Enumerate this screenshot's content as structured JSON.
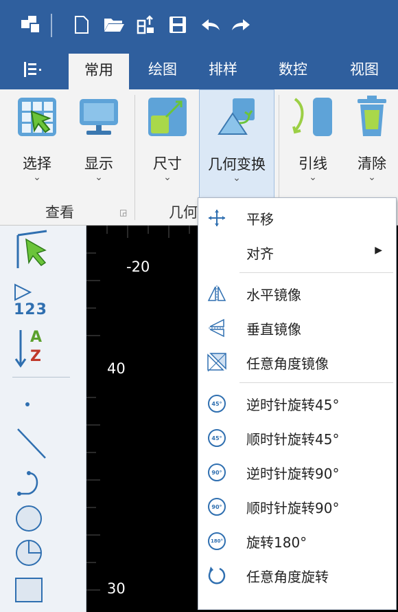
{
  "tabs": [
    {
      "label": "常用",
      "active": true
    },
    {
      "label": "绘图"
    },
    {
      "label": "排样"
    },
    {
      "label": "数控"
    },
    {
      "label": "视图"
    }
  ],
  "ribbon": {
    "buttons": [
      {
        "label": "选择",
        "arrow": "⌄"
      },
      {
        "label": "显示",
        "arrow": "⌄"
      },
      {
        "label": "尺寸",
        "arrow": "⌄"
      },
      {
        "label": "几何变换",
        "arrow": "⌄"
      },
      {
        "label": "引线",
        "arrow": "⌄"
      },
      {
        "label": "清除",
        "arrow": "⌄"
      }
    ],
    "groups": [
      "查看",
      "几何"
    ]
  },
  "left_toolbar": {
    "sort_digits": "123",
    "sort_letters": [
      "A",
      "Z"
    ]
  },
  "canvas": {
    "coords": [
      "-20",
      "40",
      "30"
    ]
  },
  "menu": {
    "items": [
      {
        "label": "平移"
      },
      {
        "label": "对齐",
        "submenu": "▶"
      },
      {
        "label": "水平镜像"
      },
      {
        "label": "垂直镜像"
      },
      {
        "label": "任意角度镜像"
      },
      {
        "label": "逆时针旋转45°",
        "badge": "45°"
      },
      {
        "label": "顺时针旋转45°",
        "badge": "45°"
      },
      {
        "label": "逆时针旋转90°",
        "badge": "90°"
      },
      {
        "label": "顺时针旋转90°",
        "badge": "90°"
      },
      {
        "label": "旋转180°",
        "badge": "180°"
      },
      {
        "label": "任意角度旋转"
      }
    ]
  },
  "colors": {
    "titlebar": "#2f5f9e",
    "accent": "#2f6fb0",
    "hover": "#dbe8f6"
  }
}
